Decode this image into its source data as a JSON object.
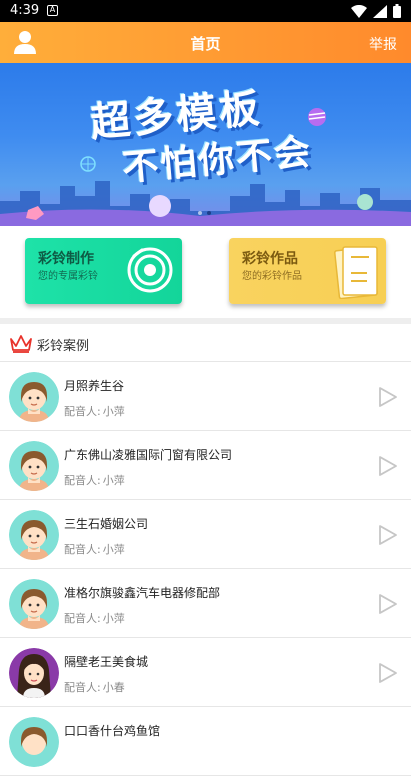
{
  "status": {
    "time": "4:39",
    "notif_glyph": "A"
  },
  "appbar": {
    "title": "首页",
    "report": "举报"
  },
  "banner": {
    "line1": "超多模板",
    "line2": "不怕你不会"
  },
  "cards": [
    {
      "title": "彩铃制作",
      "subtitle": "您的专属彩铃"
    },
    {
      "title": "彩铃作品",
      "subtitle": "您的彩铃作品"
    }
  ],
  "section": {
    "title": "彩铃案例"
  },
  "voice_label": "配音人:",
  "items": [
    {
      "name": "月照养生谷",
      "voice": "小萍",
      "avatar": "female-short"
    },
    {
      "name": "广东佛山凌雅国际门窗有限公司",
      "voice": "小萍",
      "avatar": "female-short"
    },
    {
      "name": "三生石婚姻公司",
      "voice": "小萍",
      "avatar": "female-short"
    },
    {
      "name": "准格尔旗骏鑫汽车电器修配部",
      "voice": "小萍",
      "avatar": "female-short"
    },
    {
      "name": "隔壁老王美食城",
      "voice": "小春",
      "avatar": "female-long"
    },
    {
      "name": "口口香什台鸡鱼馆",
      "voice": "",
      "avatar": "female-short"
    }
  ],
  "colors": {
    "appbar": "#ff9a32",
    "make_card": "#18dca0",
    "works_card": "#f8d159",
    "play_icon": "#c6c6c6"
  }
}
